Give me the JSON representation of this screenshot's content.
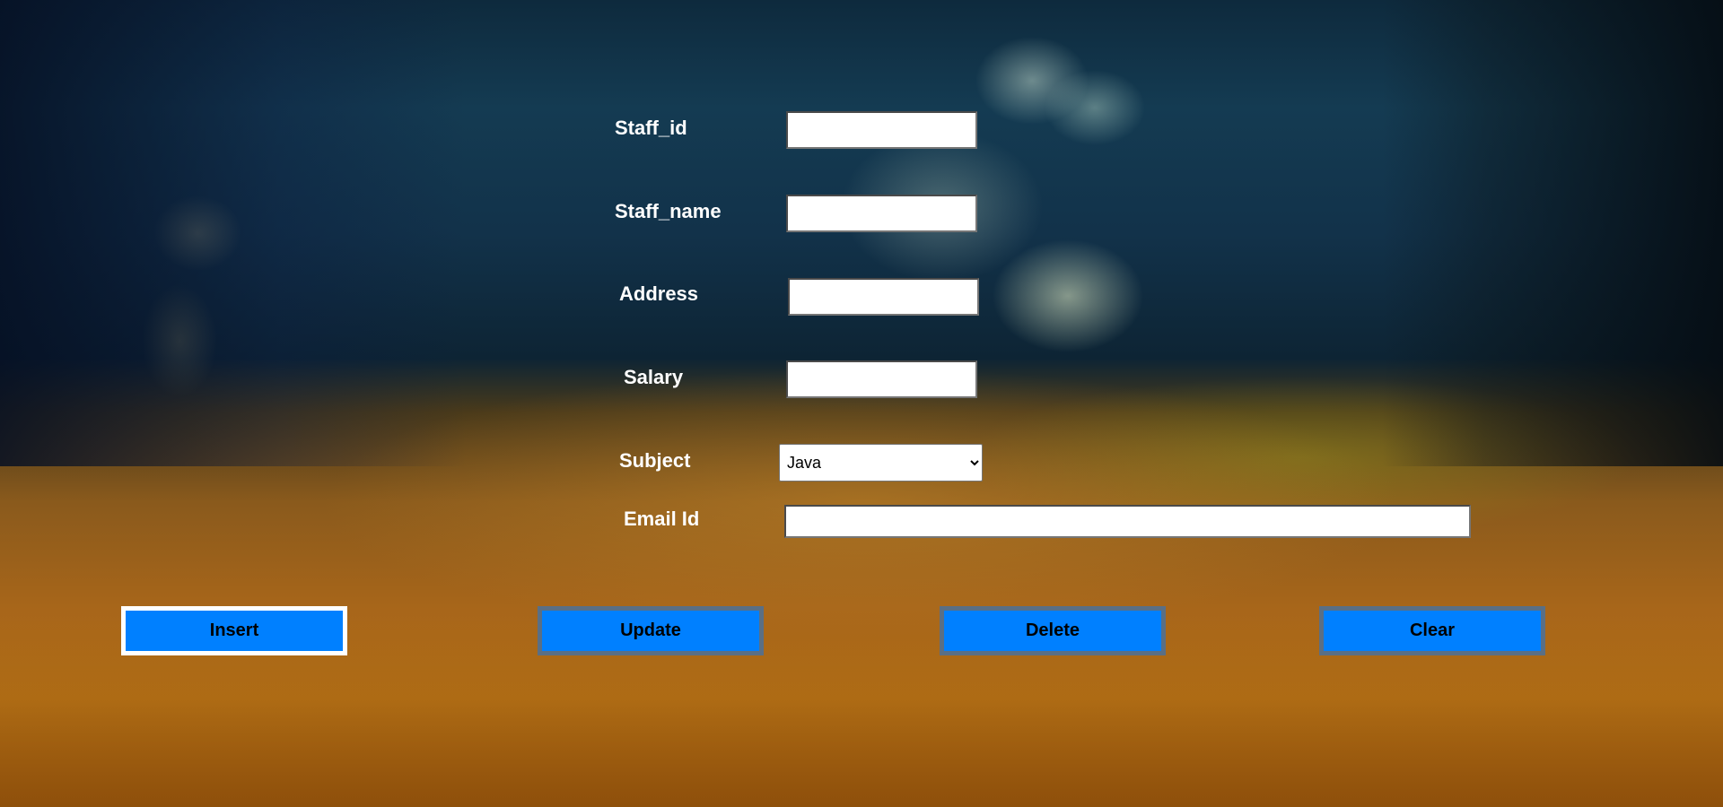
{
  "form": {
    "staff_id": {
      "label": "Staff_id",
      "value": ""
    },
    "staff_name": {
      "label": "Staff_name",
      "value": ""
    },
    "address": {
      "label": "Address",
      "value": ""
    },
    "salary": {
      "label": "Salary",
      "value": ""
    },
    "subject": {
      "label": "Subject",
      "selected": "Java"
    },
    "email": {
      "label": "Email Id",
      "value": ""
    }
  },
  "buttons": {
    "insert": "Insert",
    "update": "Update",
    "delete": "Delete",
    "clear": "Clear"
  },
  "colors": {
    "button_fill": "#0080ff",
    "label_text": "#ffffff"
  }
}
